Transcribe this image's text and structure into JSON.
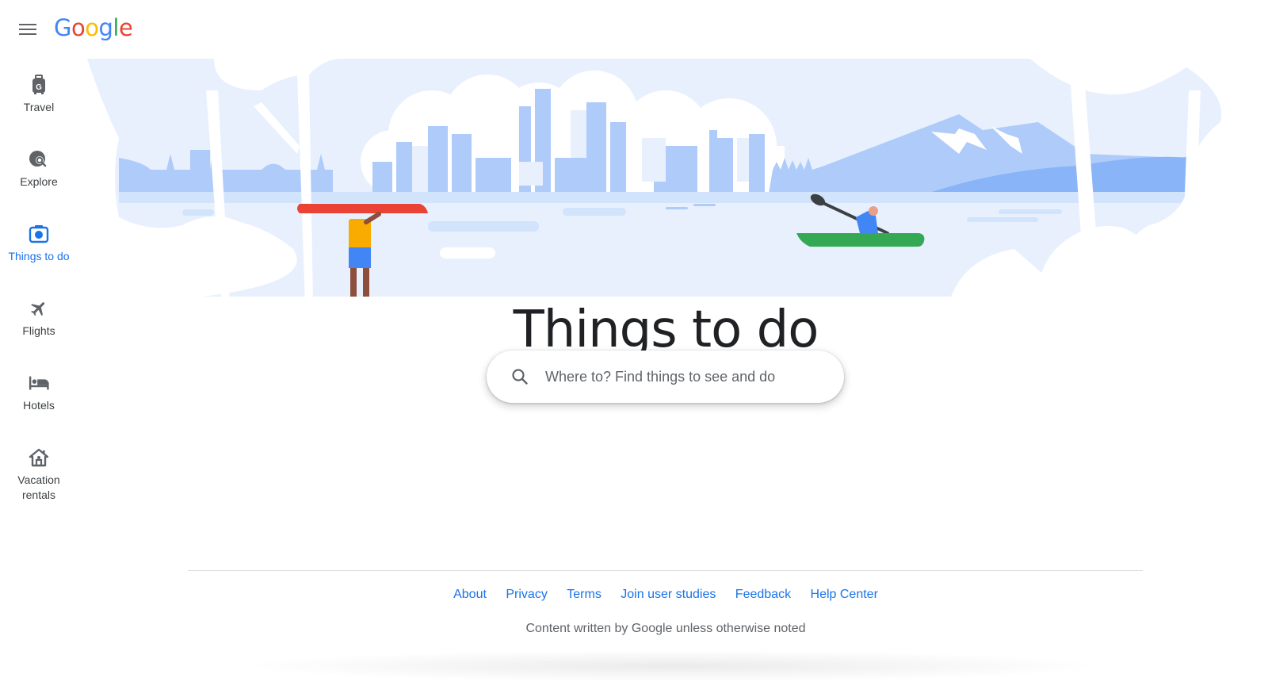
{
  "header": {
    "menu_icon": "hamburger-menu-icon",
    "logo": {
      "letters": [
        "G",
        "o",
        "o",
        "g",
        "l",
        "e"
      ]
    }
  },
  "sidebar": {
    "items": [
      {
        "label": "Travel",
        "icon": "travel-luggage-icon",
        "active": false
      },
      {
        "label": "Explore",
        "icon": "explore-globe-search-icon",
        "active": false
      },
      {
        "label": "Things to do",
        "icon": "camera-icon",
        "active": true
      },
      {
        "label": "Flights",
        "icon": "airplane-icon",
        "active": false
      },
      {
        "label": "Hotels",
        "icon": "bed-icon",
        "active": false
      },
      {
        "label": "Vacation rentals",
        "icon": "house-icon",
        "active": false
      }
    ]
  },
  "main": {
    "title": "Things to do",
    "search": {
      "placeholder": "Where to? Find things to see and do",
      "value": "",
      "icon": "search-icon"
    }
  },
  "footer": {
    "links": [
      "About",
      "Privacy",
      "Terms",
      "Join user studies",
      "Feedback",
      "Help Center"
    ],
    "note": "Content written by Google unless otherwise noted"
  },
  "colors": {
    "accent": "#1a73e8",
    "logo_blue": "#4285f4",
    "logo_red": "#ea4335",
    "logo_yellow": "#fbbc05",
    "logo_green": "#34a853",
    "illustration_light": "#e8f0fe",
    "illustration_mid": "#aecbfa",
    "canoe_red": "#ea4335",
    "kayak_green": "#34a853"
  }
}
